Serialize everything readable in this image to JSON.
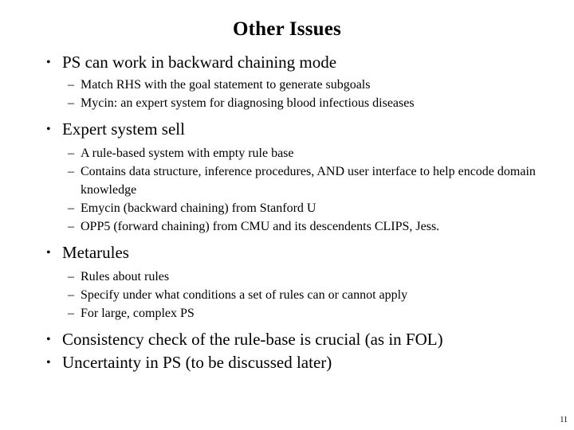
{
  "slide": {
    "title": "Other Issues",
    "page_number": "11",
    "bullet_glyph": "•",
    "dash_glyph": "–",
    "text_color": "#000000",
    "background_color": "#ffffff",
    "blocks": [
      {
        "level1": "PS can work in backward chaining mode",
        "level2": [
          "Match RHS with the goal statement to generate subgoals",
          "Mycin: an expert system for diagnosing blood infectious diseases"
        ]
      },
      {
        "level1": "Expert system sell",
        "level2": [
          "A rule-based system with empty rule base",
          "Contains data structure, inference procedures, AND user interface to help encode domain knowledge",
          "Emycin (backward chaining) from Stanford U",
          "OPP5 (forward chaining) from CMU and its descendents CLIPS, Jess."
        ]
      },
      {
        "level1": "Metarules",
        "level2": [
          "Rules about rules",
          "Specify under what conditions a set of rules can or cannot apply",
          "For large, complex PS"
        ]
      },
      {
        "level1": "Consistency check of the rule-base is crucial (as in FOL)",
        "level2": []
      },
      {
        "level1": "Uncertainty in PS (to be discussed later)",
        "level2": []
      }
    ]
  }
}
